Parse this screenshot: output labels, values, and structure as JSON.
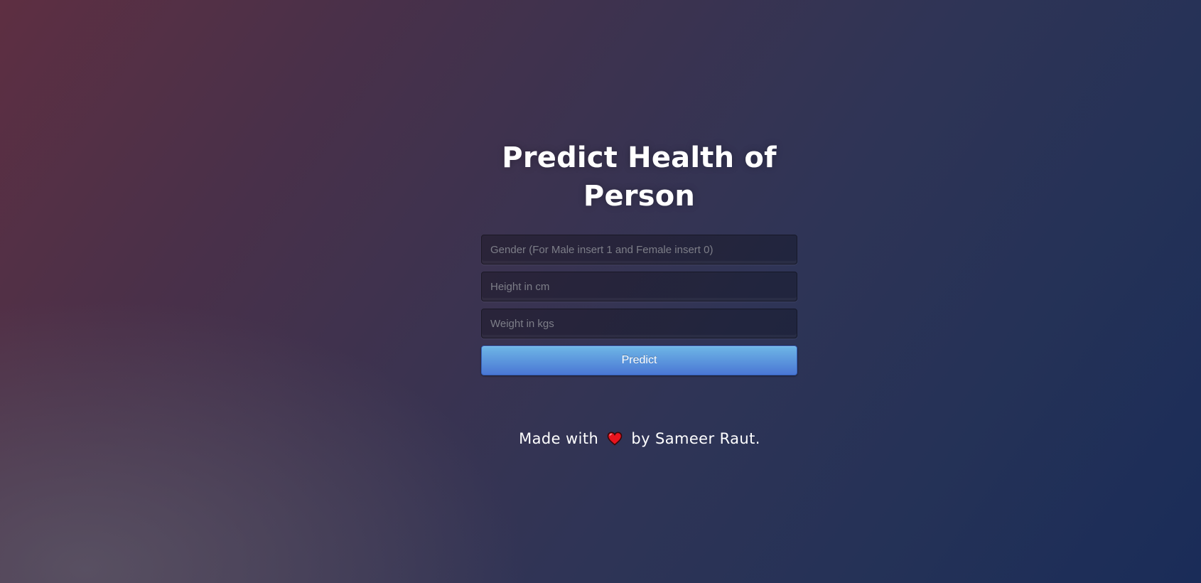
{
  "page": {
    "title": "Predict Health of Person"
  },
  "form": {
    "gender_placeholder": "Gender (For Male insert 1 and Female insert 0)",
    "height_placeholder": "Height in cm",
    "weight_placeholder": "Weight in kgs",
    "predict_label": "Predict"
  },
  "footer": {
    "prefix": "Made with",
    "icon": "heart-icon",
    "suffix": "by Sameer Raut."
  },
  "colors": {
    "button_top": "#6eb6e6",
    "button_bottom": "#4a77d4",
    "heart": "#e8141e"
  }
}
